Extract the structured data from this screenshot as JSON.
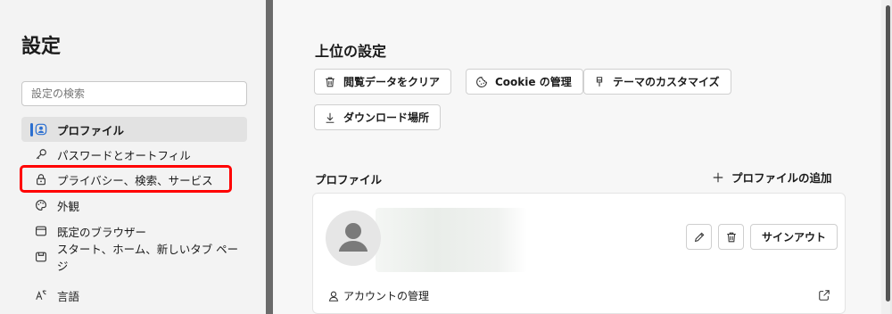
{
  "sidebar": {
    "title": "設定",
    "search_placeholder": "設定の検索",
    "items": [
      {
        "label": "プロファイル",
        "icon": "profile-icon",
        "active": true
      },
      {
        "label": "パスワードとオートフィル",
        "icon": "key-icon"
      },
      {
        "label": "プライバシー、検索、サービス",
        "icon": "lock-icon"
      },
      {
        "label": "外観",
        "icon": "palette-icon"
      },
      {
        "label": "既定のブラウザー",
        "icon": "browser-icon"
      },
      {
        "label": "スタート、ホーム、新しいタブ ページ",
        "icon": "home-tab-icon"
      },
      {
        "label": "言語",
        "icon": "language-icon"
      }
    ]
  },
  "main": {
    "top_settings_title": "上位の設定",
    "chips": [
      {
        "label": "閲覧データをクリア",
        "icon": "trash-icon"
      },
      {
        "label": "Cookie の管理",
        "icon": "cookie-icon"
      },
      {
        "label": "テーマのカスタマイズ",
        "icon": "brush-icon"
      },
      {
        "label": "ダウンロード場所",
        "icon": "download-icon"
      }
    ],
    "profile_section_title": "プロファイル",
    "add_profile_label": "プロファイルの追加",
    "signout_label": "サインアウト",
    "account_manage_label": "アカウントの管理"
  },
  "colors": {
    "accent": "#2b6fd0",
    "highlight": "#ff0000"
  }
}
